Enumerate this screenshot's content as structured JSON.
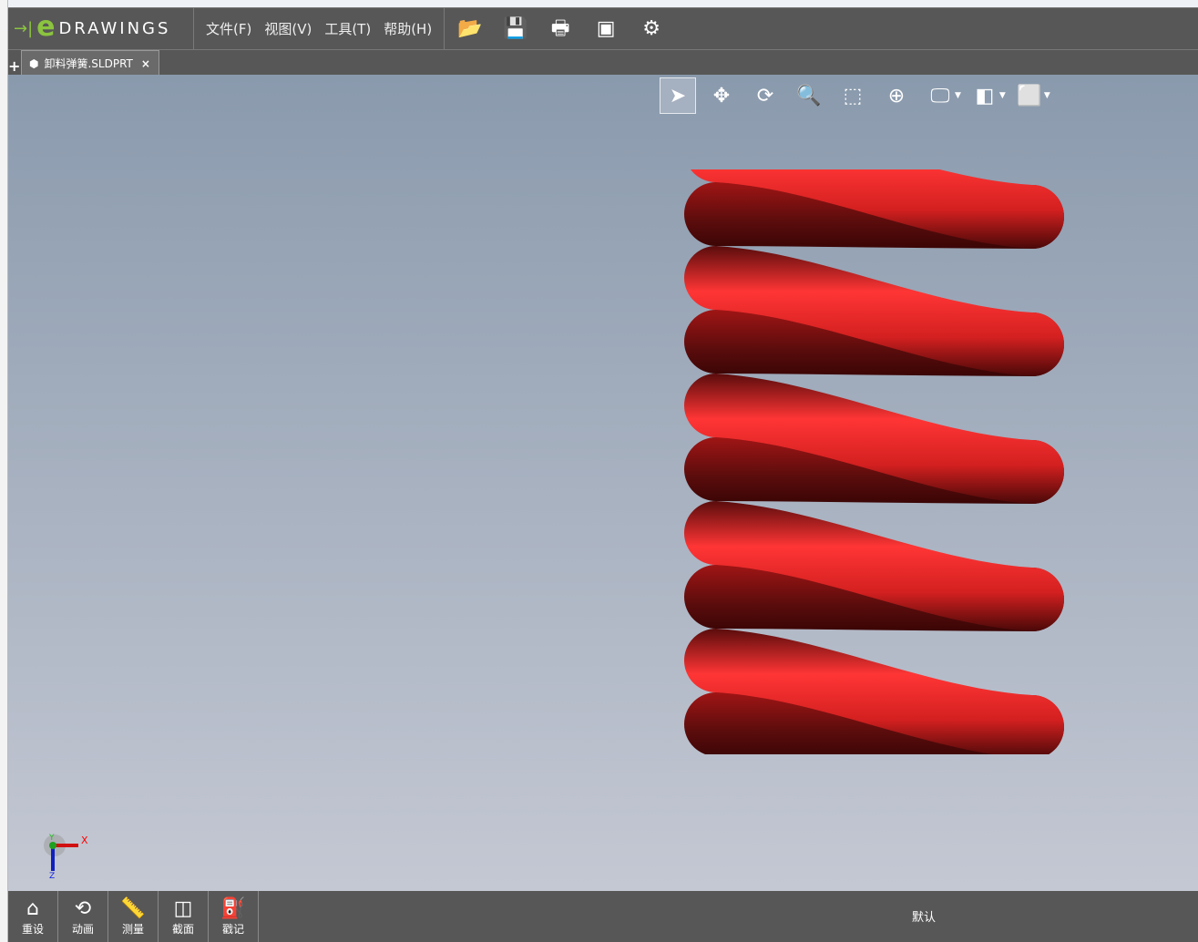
{
  "app": {
    "logo_text": "DRAWINGS",
    "logo_letter": "e"
  },
  "menu": [
    "文件(F)",
    "视图(V)",
    "工具(T)",
    "帮助(H)"
  ],
  "toolbar_icons": [
    "open-icon",
    "save-icon",
    "print-icon",
    "page-setup-icon",
    "settings-icon"
  ],
  "tab": {
    "title": "卸料弹簧.SLDPRT",
    "close": "×",
    "add": "+"
  },
  "view_tools": [
    "select-icon",
    "pan-icon",
    "rotate-icon",
    "zoom-icon",
    "zoom-area-icon",
    "zoom-fit-icon",
    "display-style-icon",
    "view-orientation-icon",
    "standard-views-icon"
  ],
  "triad": {
    "x": "X",
    "y": "Y",
    "z": "Z"
  },
  "bottom": [
    {
      "label": "重设",
      "icon": "home-icon"
    },
    {
      "label": "动画",
      "icon": "animate-icon"
    },
    {
      "label": "测量",
      "icon": "measure-icon"
    },
    {
      "label": "截面",
      "icon": "section-icon"
    },
    {
      "label": "戳记",
      "icon": "stamp-icon"
    }
  ],
  "status": "默认",
  "colors": {
    "spring": "#e02424",
    "toolbar": "#575757",
    "accent": "#8bc43f"
  }
}
